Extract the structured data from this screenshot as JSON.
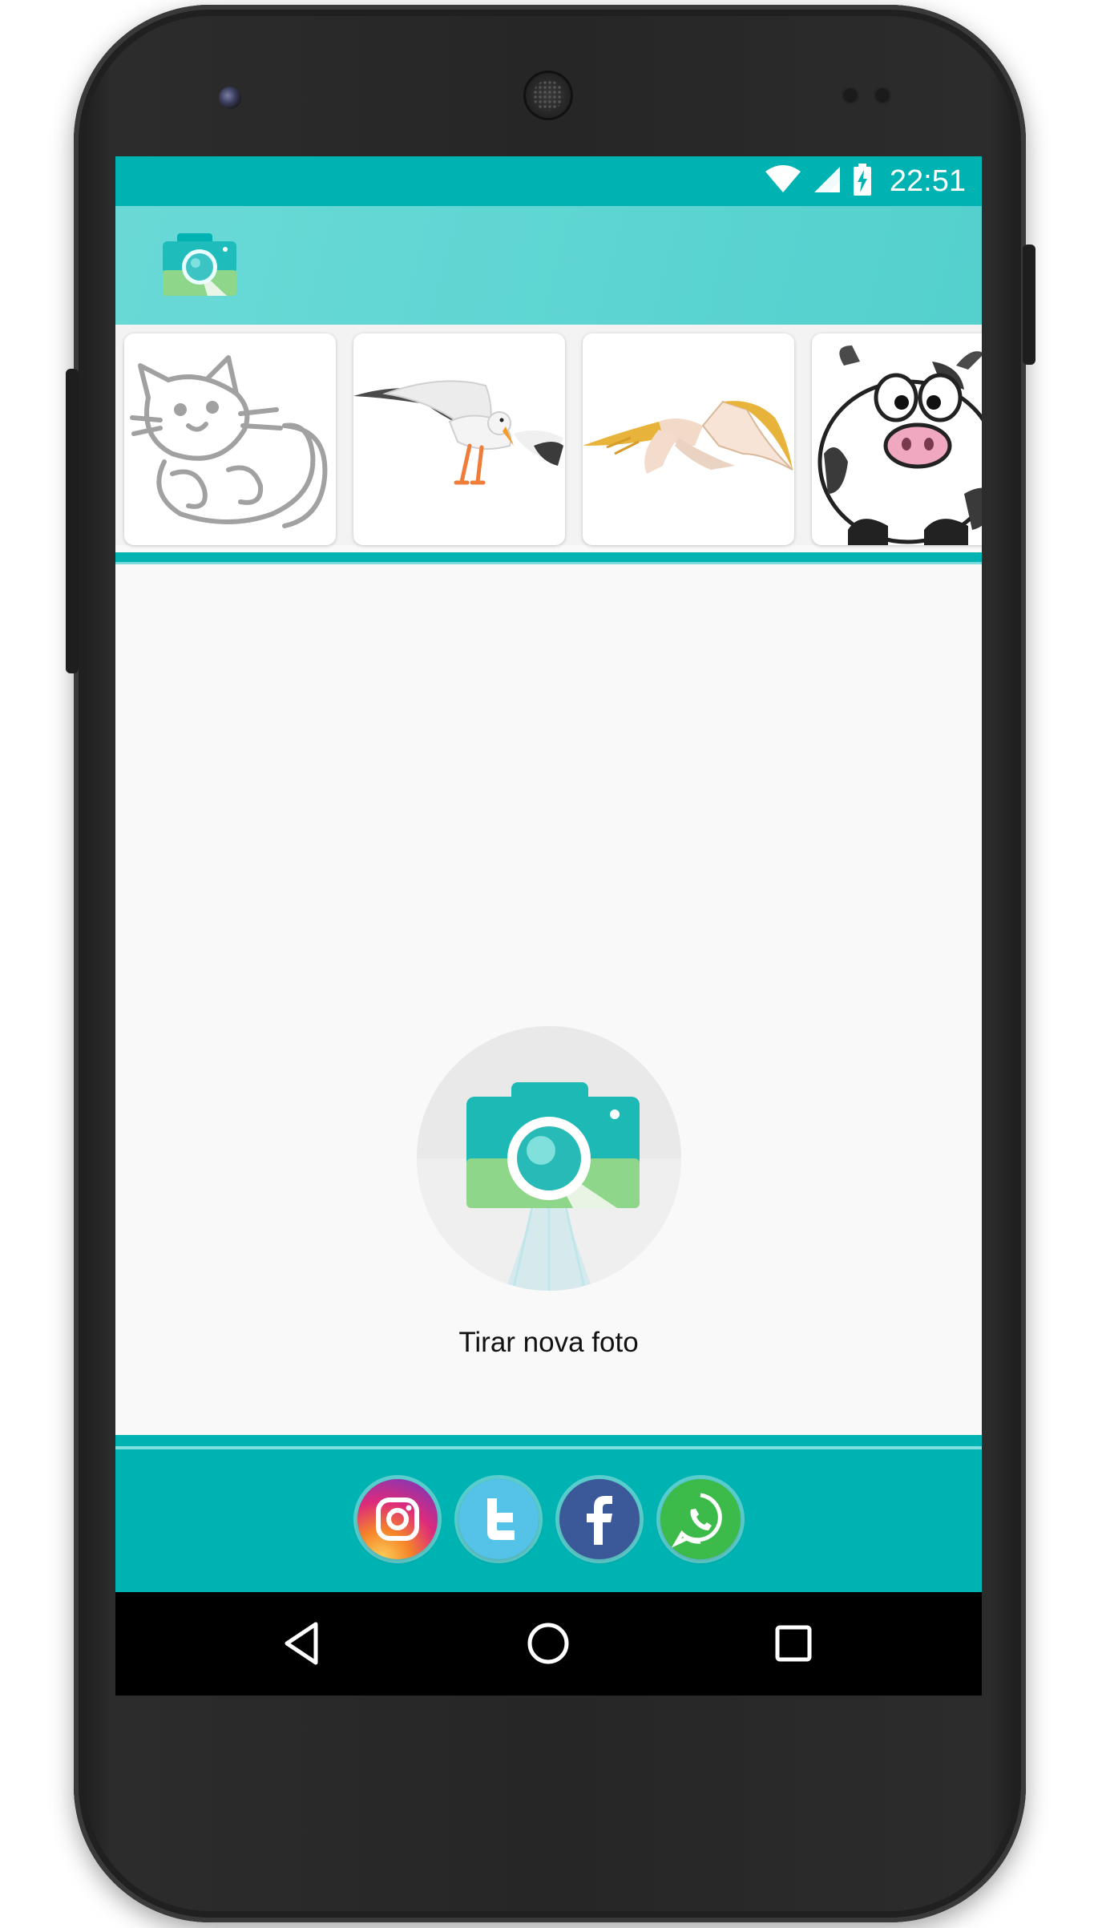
{
  "status_bar": {
    "time": "22:51",
    "icons": [
      "wifi-icon",
      "signal-icon",
      "battery-charging-icon"
    ]
  },
  "app_bar": {
    "logo_icon": "camera-search-logo-icon"
  },
  "thumbnails": [
    {
      "name": "cat-sketch",
      "icon": "cat-sketch-image"
    },
    {
      "name": "seagull",
      "icon": "seagull-image"
    },
    {
      "name": "pterodactyl",
      "icon": "pterodactyl-image"
    },
    {
      "name": "cow",
      "icon": "cow-cartoon-image"
    }
  ],
  "main": {
    "camera_label": "Tirar nova foto"
  },
  "social": [
    {
      "name": "instagram",
      "color": "#c13584"
    },
    {
      "name": "twitter",
      "color": "#55c2e8"
    },
    {
      "name": "facebook",
      "color": "#3b5998"
    },
    {
      "name": "whatsapp",
      "color": "#3dbb4a"
    }
  ],
  "colors": {
    "teal": "#00b3b3",
    "teal_light": "#5fd6d3",
    "camera_green": "#8ed68a"
  }
}
